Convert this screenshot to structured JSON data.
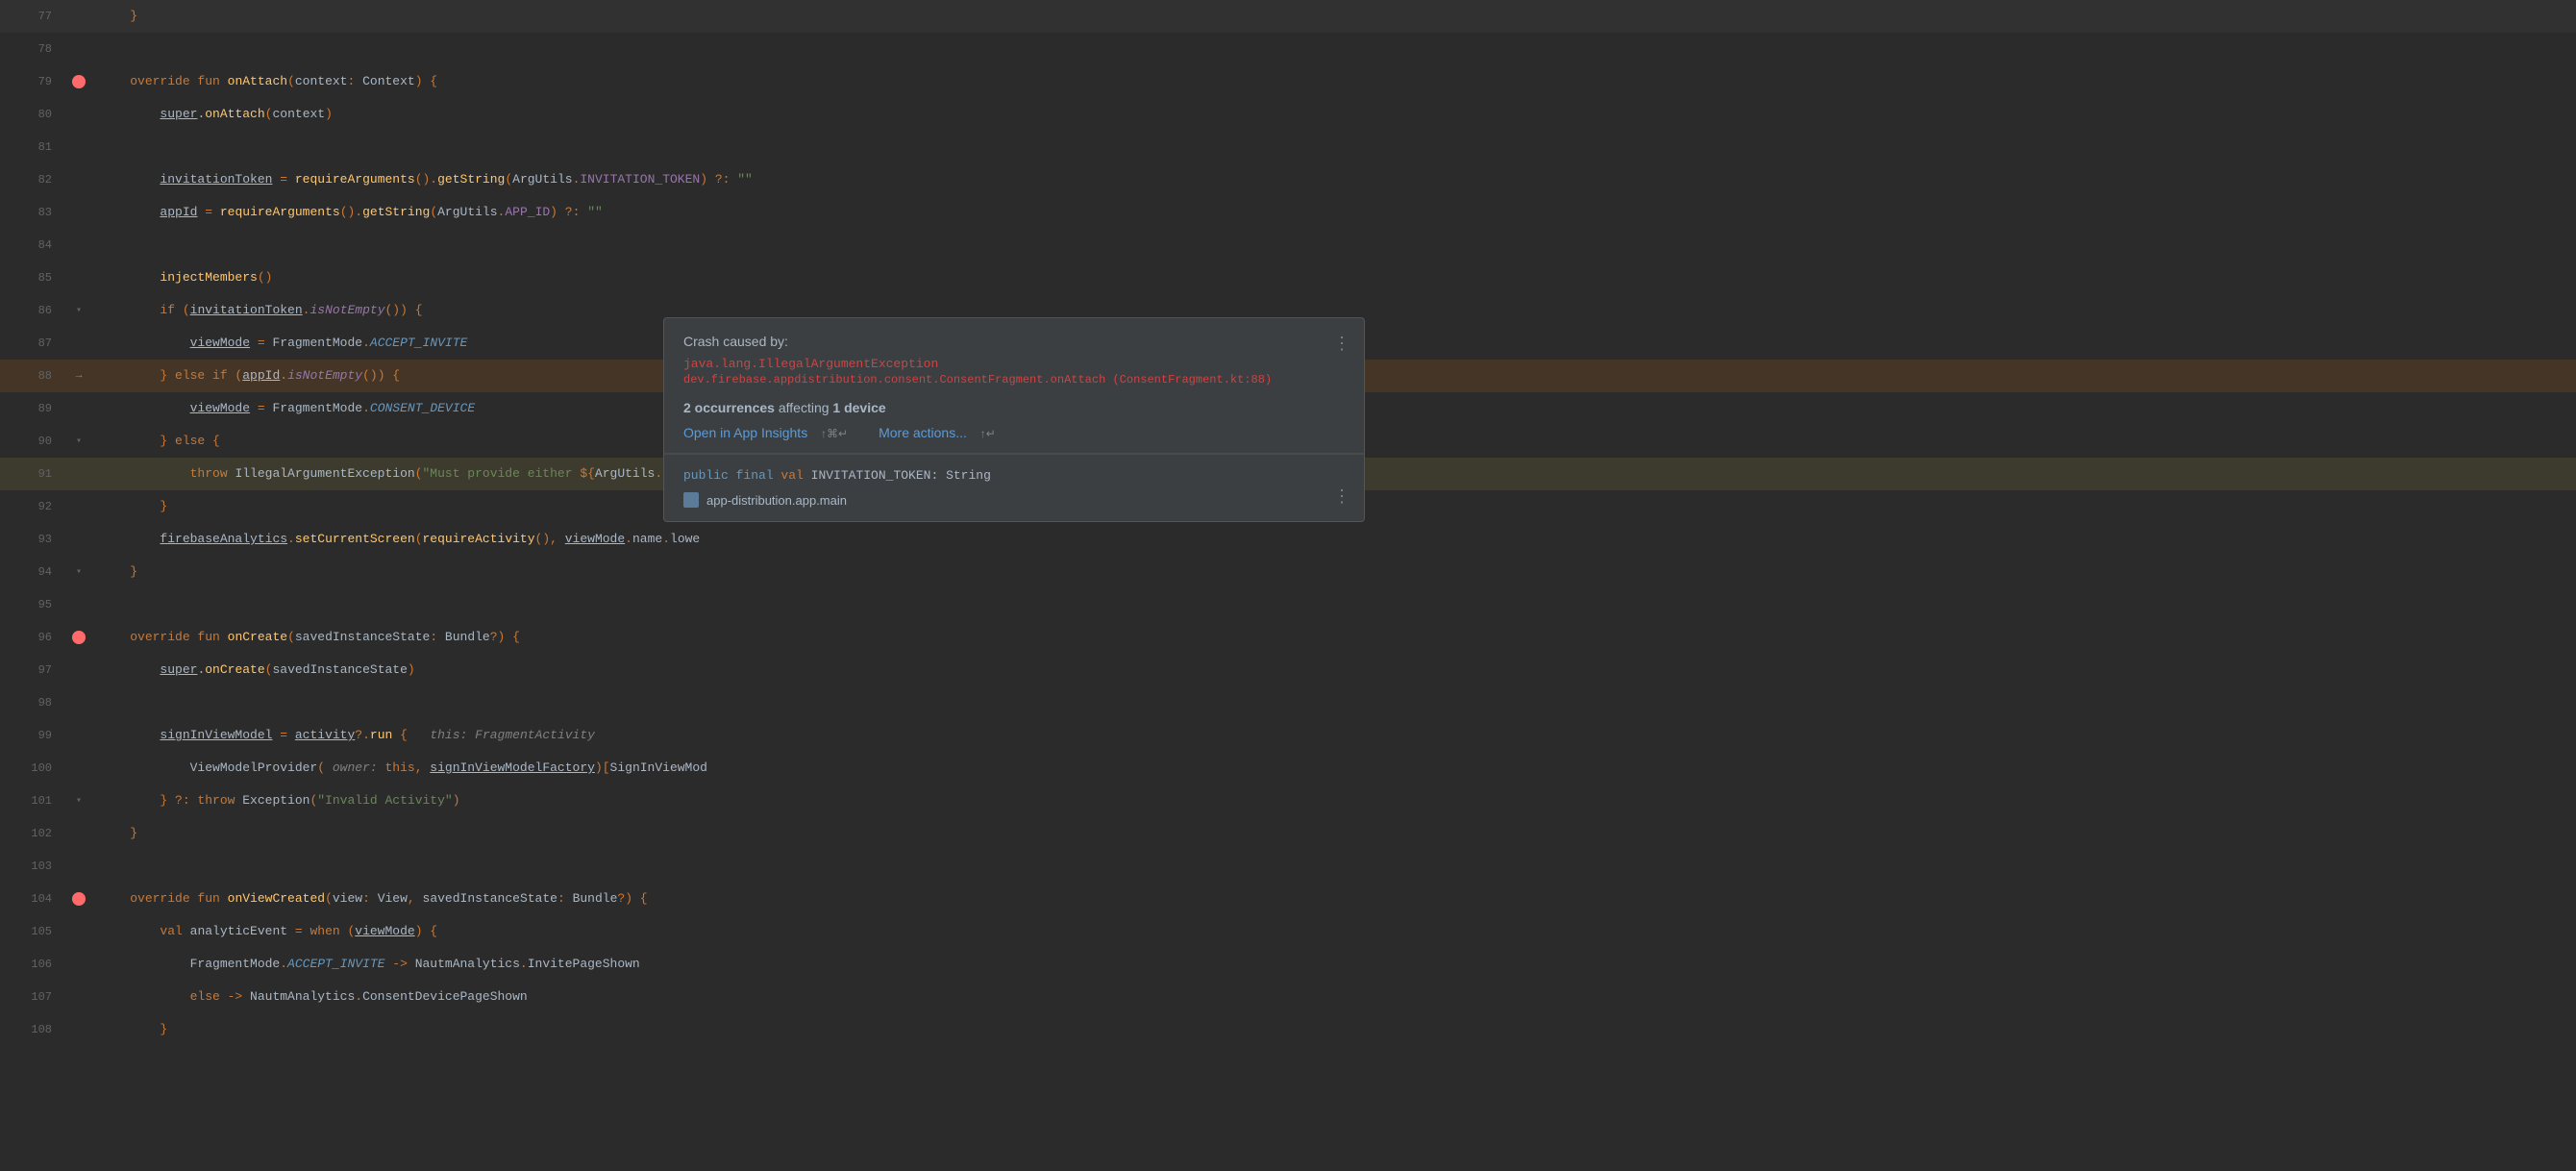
{
  "editor": {
    "background": "#2b2b2b",
    "lines": [
      {
        "num": 77,
        "gutter": "",
        "content": "    }"
      },
      {
        "num": 78,
        "gutter": "",
        "content": ""
      },
      {
        "num": 79,
        "gutter": "bp",
        "content": "    override fun onAttach(context: Context) {"
      },
      {
        "num": 80,
        "gutter": "",
        "content": "        super.onAttach(context)"
      },
      {
        "num": 81,
        "gutter": "",
        "content": ""
      },
      {
        "num": 82,
        "gutter": "",
        "content": "        invitationToken = requireArguments().getString(ArgUtils.INVITATION_TOKEN) ?: \"\""
      },
      {
        "num": 83,
        "gutter": "",
        "content": "        appId = requireArguments().getString(ArgUtils.APP_ID) ?: \"\""
      },
      {
        "num": 84,
        "gutter": "",
        "content": ""
      },
      {
        "num": 85,
        "gutter": "",
        "content": "        injectMembers()"
      },
      {
        "num": 86,
        "gutter": "fold",
        "content": "        if (invitationToken.isNotEmpty()) {"
      },
      {
        "num": 87,
        "gutter": "",
        "content": "            viewMode = FragmentMode.ACCEPT_INVITE"
      },
      {
        "num": 88,
        "gutter": "arrow",
        "content": "        } else if (appId.isNotEmpty()) {"
      },
      {
        "num": 89,
        "gutter": "",
        "content": "            viewMode = FragmentMode.CONSENT_DEVICE"
      },
      {
        "num": 90,
        "gutter": "fold",
        "content": "        } else {"
      },
      {
        "num": 91,
        "gutter": "",
        "content": "            throw IllegalArgumentException(\"Must provide either ${ArgUtils.INVITATION_TOKEN} or ${ArgUtils.APP_ID} argument\")"
      },
      {
        "num": 92,
        "gutter": "",
        "content": "        }"
      },
      {
        "num": 93,
        "gutter": "",
        "content": "        firebaseAnalytics.setCurrentScreen(requireActivity(), viewMode.name.lowe"
      },
      {
        "num": 94,
        "gutter": "fold",
        "content": "    }"
      },
      {
        "num": 95,
        "gutter": "",
        "content": ""
      },
      {
        "num": 96,
        "gutter": "bp",
        "content": "    override fun onCreate(savedInstanceState: Bundle?) {"
      },
      {
        "num": 97,
        "gutter": "",
        "content": "        super.onCreate(savedInstanceState)"
      },
      {
        "num": 98,
        "gutter": "",
        "content": ""
      },
      {
        "num": 99,
        "gutter": "",
        "content": "        signInViewModel = activity?.run {   this: FragmentActivity"
      },
      {
        "num": 100,
        "gutter": "",
        "content": "            ViewModelProvider( owner: this, signInViewModelFactory)[SignInViewMod"
      },
      {
        "num": 101,
        "gutter": "fold",
        "content": "        } ?: throw Exception(\"Invalid Activity\")"
      },
      {
        "num": 102,
        "gutter": "",
        "content": "    }"
      },
      {
        "num": 103,
        "gutter": "",
        "content": ""
      },
      {
        "num": 104,
        "gutter": "bp",
        "content": "    override fun onViewCreated(view: View, savedInstanceState: Bundle?) {"
      },
      {
        "num": 105,
        "gutter": "",
        "content": "        val analyticEvent = when (viewMode) {"
      },
      {
        "num": 106,
        "gutter": "",
        "content": "            FragmentMode.ACCEPT_INVITE -> NautmAnalytics.InvitePageShown"
      },
      {
        "num": 107,
        "gutter": "",
        "content": "            else -> NautmAnalytics.ConsentDevicePageShown"
      },
      {
        "num": 108,
        "gutter": "",
        "content": "        }"
      }
    ]
  },
  "popup": {
    "title": "Crash caused by:",
    "exception1": "java.lang.IllegalArgumentException",
    "exception2": "dev.firebase.appdistribution.consent.ConsentFragment.onAttach (ConsentFragment.kt:88)",
    "occurrences_text": "2 occurrences affecting 1 device",
    "link1_label": "Open in App Insights",
    "link1_shortcut": "↑⌘↵",
    "link2_label": "More actions...",
    "link2_shortcut": "↑↵",
    "code_line": "public final val INVITATION_TOKEN: String",
    "module_label": "app-distribution.app.main",
    "three_dots": "⋮",
    "three_dots_bottom": "⋮"
  }
}
